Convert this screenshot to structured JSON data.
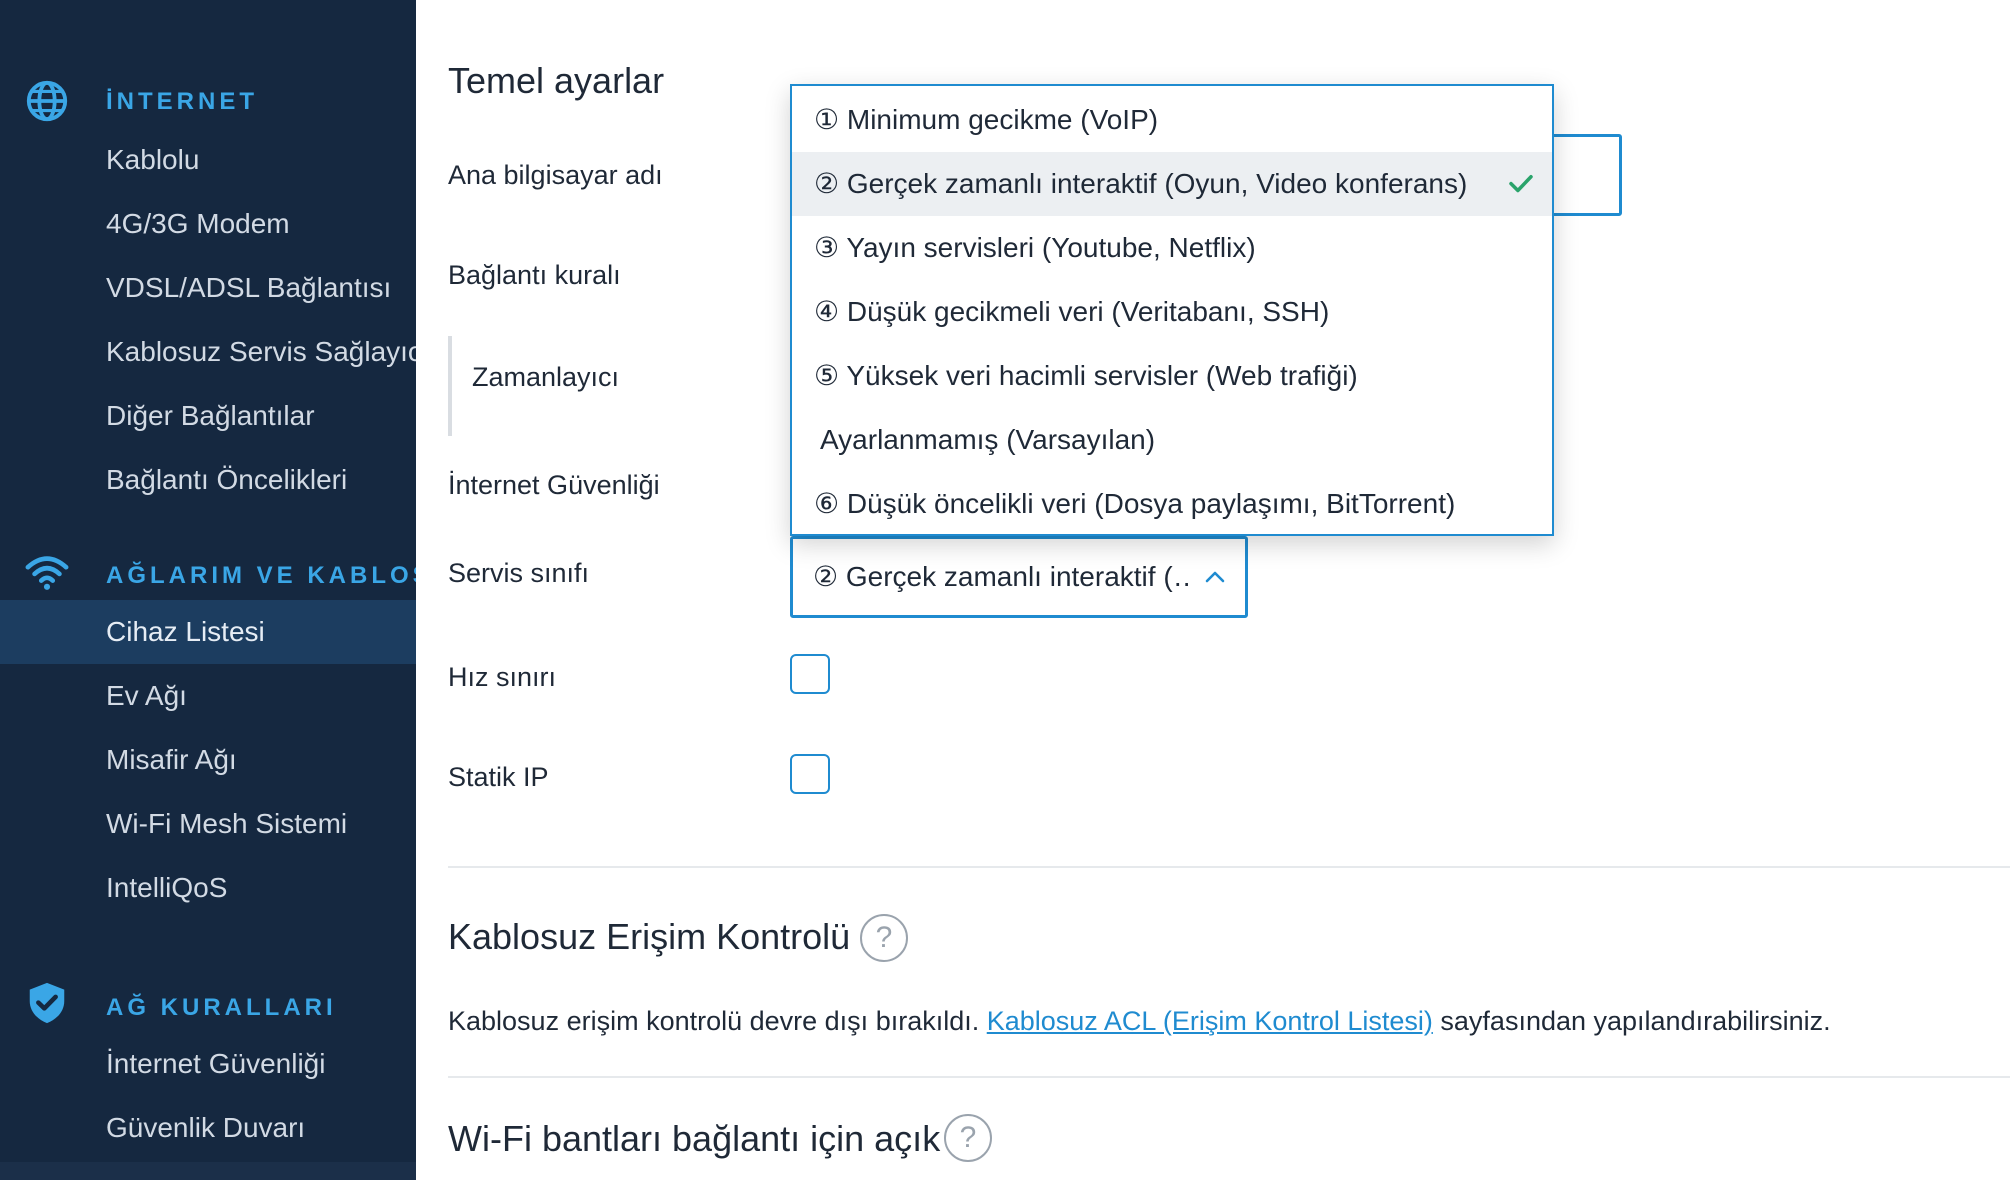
{
  "sidebar": {
    "sections": [
      {
        "heading": "İNTERNET",
        "icon": "globe-icon",
        "items": [
          "Kablolu",
          "4G/3G Modem",
          "VDSL/ADSL Bağlantısı",
          "Kablosuz Servis Sağlayıcı",
          "Diğer Bağlantılar",
          "Bağlantı Öncelikleri"
        ]
      },
      {
        "heading": "AĞLARIM VE KABLOSUZ",
        "icon": "wifi-icon",
        "items": [
          "Cihaz Listesi",
          "Ev Ağı",
          "Misafir Ağı",
          "Wi-Fi Mesh Sistemi",
          "IntelliQoS"
        ]
      },
      {
        "heading": "AĞ KURALLARI",
        "icon": "shield-check-icon",
        "items": [
          "İnternet Güvenliği",
          "Güvenlik Duvarı"
        ]
      }
    ],
    "active_item": "Cihaz Listesi",
    "accent_color": "#3aa6e6",
    "background_color": "#152840"
  },
  "main": {
    "basic_settings_title": "Temel ayarlar",
    "labels": {
      "host_name": "Ana bilgisayar adı",
      "connection_rule": "Bağlantı kuralı",
      "scheduler": "Zamanlayıcı",
      "internet_security": "İnternet Güvenliği",
      "service_class": "Servis sınıfı",
      "speed_limit": "Hız sınırı",
      "static_ip": "Statik IP"
    },
    "service_class_select": {
      "value": "② Gerçek zamanlı interaktif (…",
      "options": [
        "① Minimum gecikme (VoIP)",
        "② Gerçek zamanlı interaktif (Oyun, Video konferans)",
        "③ Yayın servisleri (Youtube, Netflix)",
        "④ Düşük gecikmeli veri (Veritabanı, SSH)",
        "⑤ Yüksek veri hacimli servisler (Web trafiği)",
        "Ayarlanmamış (Varsayılan)",
        "⑥ Düşük öncelikli veri (Dosya paylaşımı, BitTorrent)"
      ],
      "selected_index": 1
    },
    "speed_limit_checked": false,
    "static_ip_checked": false,
    "wireless_access_title": "Kablosuz Erişim Kontrolü",
    "wireless_access_text_before": "Kablosuz erişim kontrolü devre dışı bırakıldı. ",
    "wireless_access_link": "Kablosuz ACL (Erişim Kontrol Listesi)",
    "wireless_access_text_after": " sayfasından yapılandırabilirsiniz.",
    "wifi_bands_title": "Wi-Fi bantları bağlantı için açık",
    "help_symbol": "?",
    "check_color": "#2aa36b",
    "field_border_color": "#1f8bd0"
  }
}
